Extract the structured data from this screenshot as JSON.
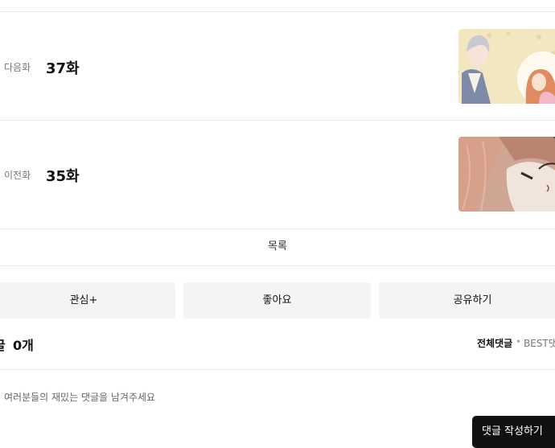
{
  "episodes": [
    {
      "caption": "다음화",
      "number": "37화"
    },
    {
      "caption": "이전화",
      "number": "35화"
    }
  ],
  "list_label": "목록",
  "actions": {
    "interest": "관심+",
    "like": "좋아요",
    "share": "공유하기"
  },
  "comments": {
    "heading": "글",
    "count": "0개",
    "sort_all": "전체댓글",
    "sort_separator": "•",
    "sort_best": "BEST댓",
    "placeholder": "여러분들의 재밌는 댓글을 남겨주세요",
    "write_button": "댓글 작성하기"
  },
  "colors": {
    "divider": "#ececec",
    "button_bg": "#f4f4f4",
    "write_button_bg": "#111111"
  }
}
